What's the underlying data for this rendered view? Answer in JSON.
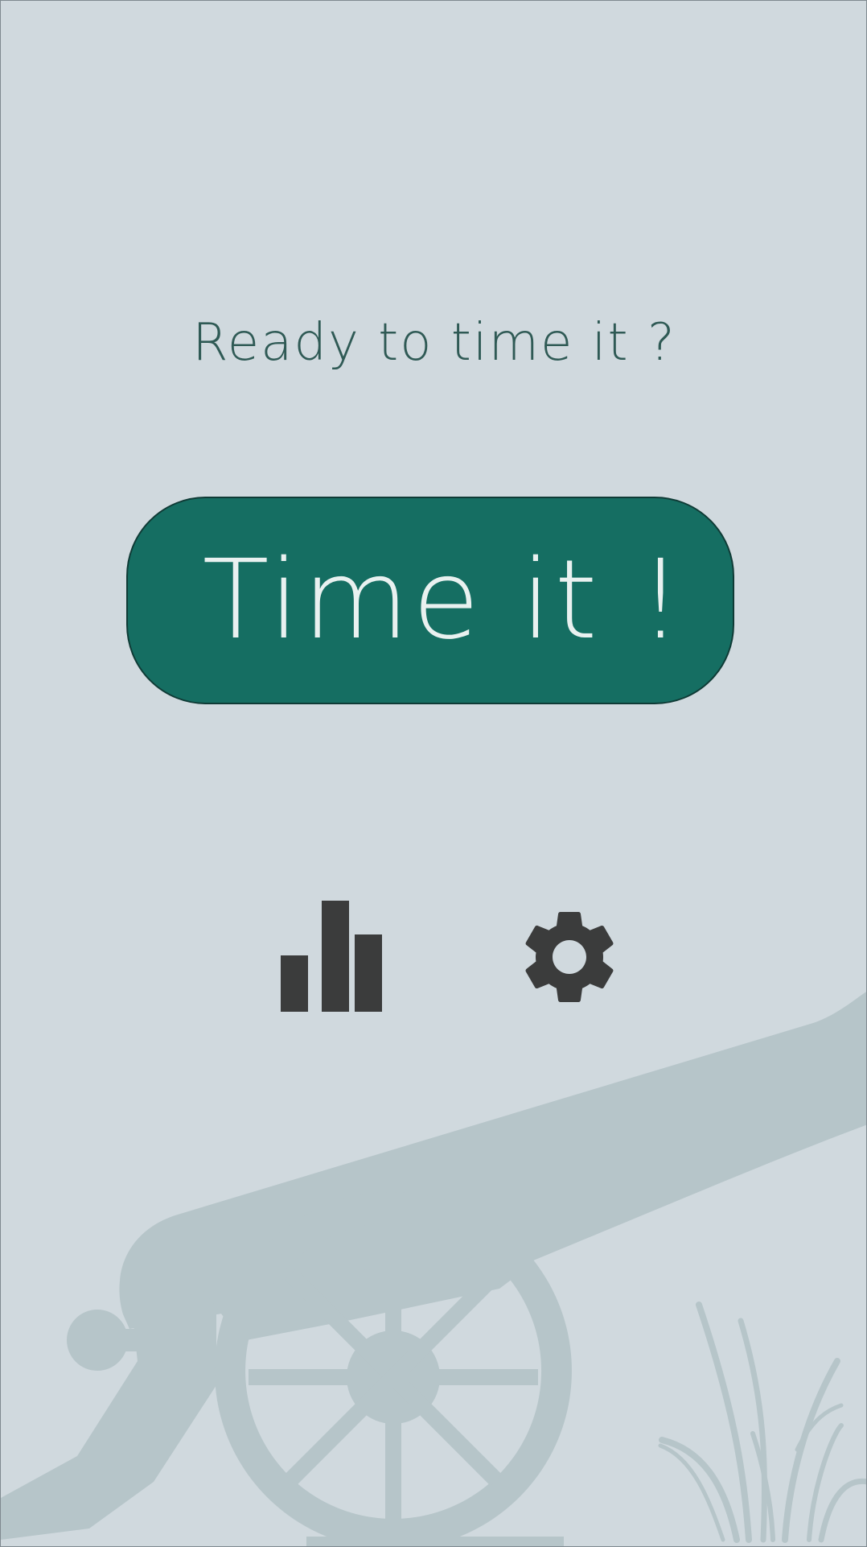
{
  "main": {
    "prompt": "Ready to time it ?",
    "time_button_label": "Time it !"
  },
  "actions": {
    "stats_icon": "bar-chart-icon",
    "settings_icon": "gear-icon"
  },
  "background": {
    "illustration": "cannon-illustration",
    "grass": "grass-illustration"
  },
  "colors": {
    "background": "#d0d9de",
    "accent": "#156e62",
    "prompt_text": "#2f5a55",
    "icon": "#3b3c3c",
    "silhouette": "#b6c5c9"
  }
}
